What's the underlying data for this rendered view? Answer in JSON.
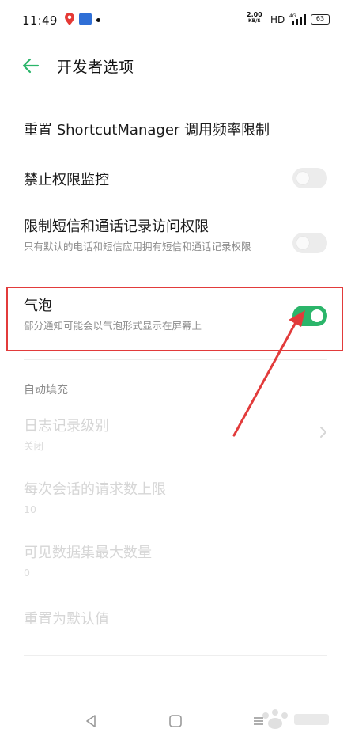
{
  "status_bar": {
    "time": "11:49",
    "net_speed_value": "2.00",
    "net_speed_unit": "KB/S",
    "hd": "HD",
    "network": "4G",
    "battery": "63"
  },
  "header": {
    "title": "开发者选项"
  },
  "settings": {
    "reset_shortcut": {
      "title": "重置 ShortcutManager 调用频率限制"
    },
    "disable_permission_monitor": {
      "title": "禁止权限监控",
      "toggle": "off"
    },
    "restrict_sms_call": {
      "title": "限制短信和通话记录访问权限",
      "subtitle": "只有默认的电话和短信应用拥有短信和通话记录权限",
      "toggle": "off"
    },
    "bubbles": {
      "title": "气泡",
      "subtitle": "部分通知可能会以气泡形式显示在屏幕上",
      "toggle": "on"
    }
  },
  "autofill": {
    "section_title": "自动填充",
    "log_level": {
      "title": "日志记录级别",
      "value": "关闭"
    },
    "max_requests": {
      "title": "每次会话的请求数上限",
      "value": "10"
    },
    "max_datasets": {
      "title": "可见数据集最大数量",
      "value": "0"
    },
    "reset_defaults": {
      "title": "重置为默认值"
    }
  },
  "colors": {
    "accent_green": "#2bb56a",
    "annotation_red": "#e23b3b"
  },
  "icons": {
    "back": "arrow-left-icon",
    "chevron": "chevron-right-icon",
    "location": "location-pin-icon"
  }
}
